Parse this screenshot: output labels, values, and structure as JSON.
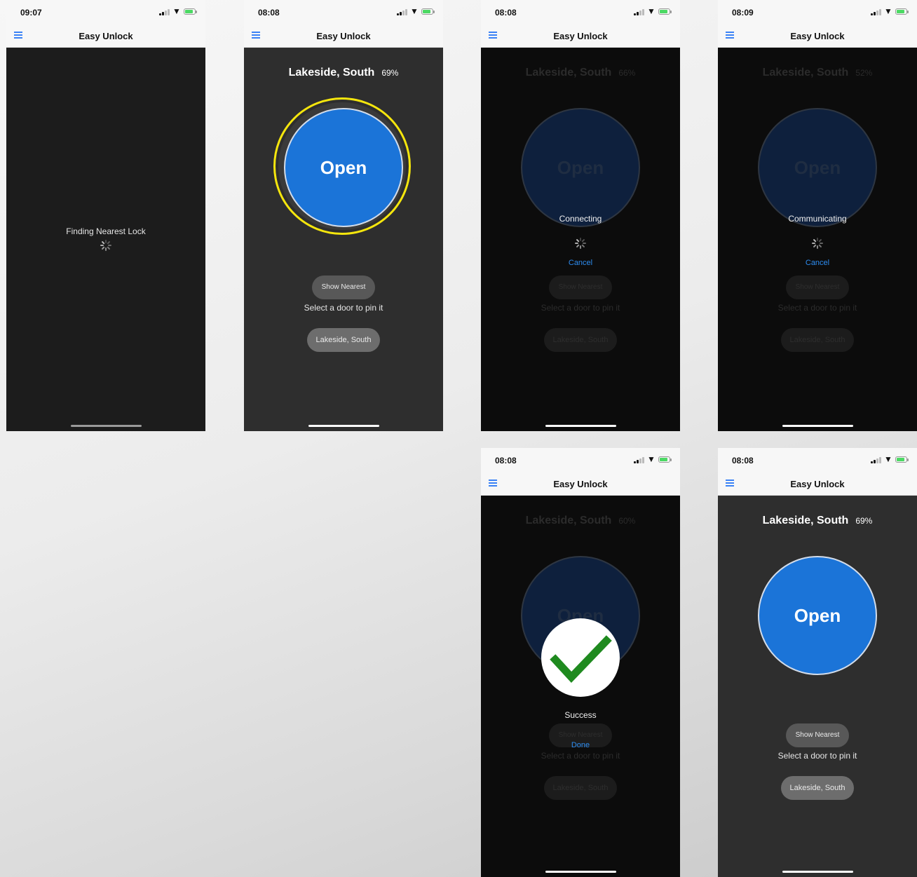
{
  "app_title": "Easy Unlock",
  "colors": {
    "accent": "#1b74d8",
    "highlight": "#f5e60d",
    "link": "#2d8cf0",
    "success_check": "#1f8a1f"
  },
  "screens": [
    {
      "time": "09:07",
      "status_text": "Finding Nearest Lock"
    },
    {
      "time": "08:08",
      "location": "Lakeside, South",
      "percent": "69%",
      "open_label": "Open",
      "show_nearest": "Show Nearest",
      "select_text": "Select a door to pin it",
      "door_button": "Lakeside, South"
    },
    {
      "time": "08:08",
      "location": "Lakeside, South",
      "percent": "66%",
      "open_label": "Open",
      "status_text": "Connecting",
      "cancel_label": "Cancel",
      "show_nearest": "Show Nearest",
      "select_text": "Select a door to pin it",
      "door_button": "Lakeside, South"
    },
    {
      "time": "08:09",
      "location": "Lakeside, South",
      "percent": "52%",
      "open_label": "Open",
      "status_text": "Communicating",
      "cancel_label": "Cancel",
      "show_nearest": "Show Nearest",
      "select_text": "Select a door to pin it",
      "door_button": "Lakeside, South"
    },
    {
      "time": "08:08",
      "location": "Lakeside, South",
      "percent": "60%",
      "open_label": "Open",
      "status_text": "Success",
      "done_label": "Done",
      "show_nearest": "Show Nearest",
      "select_text": "Select a door to pin it",
      "door_button": "Lakeside, South"
    },
    {
      "time": "08:08",
      "location": "Lakeside, South",
      "percent": "69%",
      "open_label": "Open",
      "show_nearest": "Show Nearest",
      "select_text": "Select a door to pin it",
      "door_button": "Lakeside, South"
    }
  ]
}
